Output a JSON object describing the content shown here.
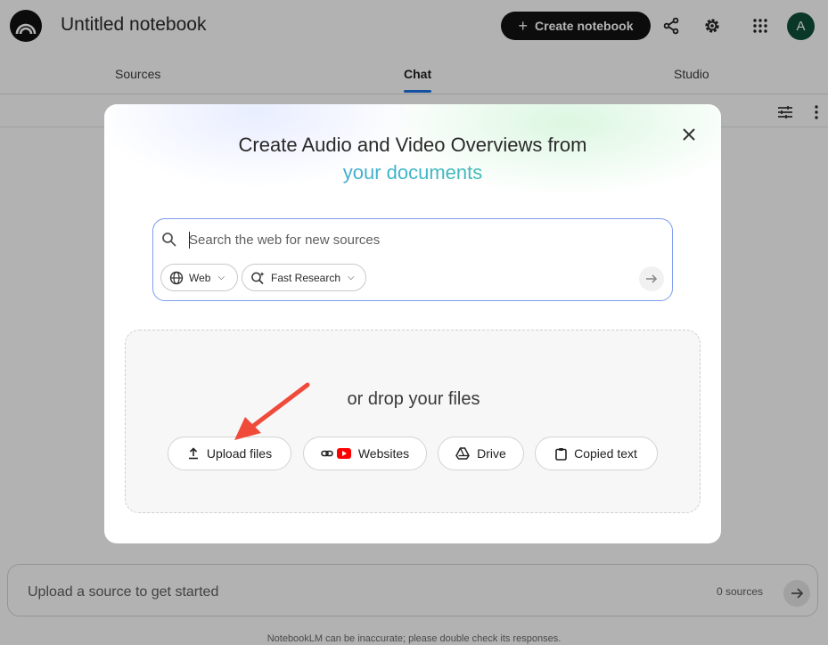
{
  "topbar": {
    "title": "Untitled notebook",
    "create_label": "Create notebook",
    "avatar_letter": "A"
  },
  "tabs": {
    "sources": "Sources",
    "chat": "Chat",
    "studio": "Studio"
  },
  "chat": {
    "placeholder": "Upload a source to get started",
    "source_count": "0 sources",
    "disclaimer": "NotebookLM can be inaccurate; please double check its responses."
  },
  "modal": {
    "heading_line1": "Create Audio and Video Overviews from",
    "heading_line2": "your documents",
    "search_placeholder": "Search the web for new sources",
    "web_chip": "Web",
    "research_chip": "Fast Research",
    "drop_label": "or drop your files",
    "upload_label": "Upload files",
    "websites_label": "Websites",
    "drive_label": "Drive",
    "copied_label": "Copied text"
  },
  "colors": {
    "accent_blue": "#1a73e8",
    "avatar_green": "#0d4f3a",
    "arrow_red": "#f04a3a"
  }
}
